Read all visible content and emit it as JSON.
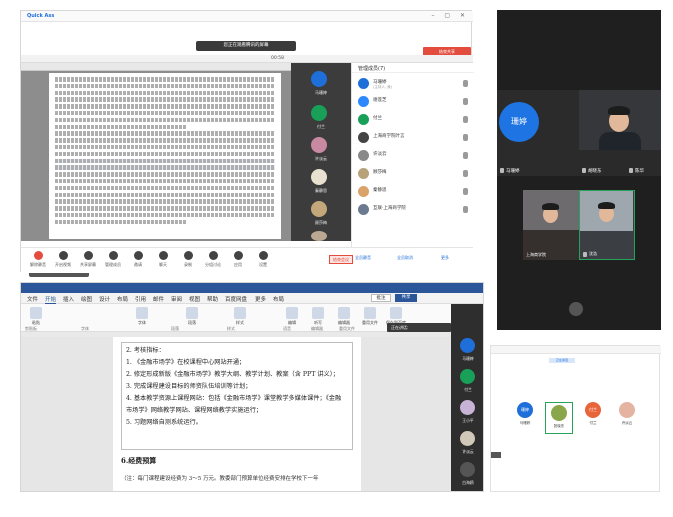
{
  "panel1": {
    "app_name": "Quick Ass",
    "window_info": "",
    "share_banner": "您正在观看腾讯的屏幕",
    "stop_share": "结束共享",
    "share_time": "00:58",
    "thumbnail_label": "共享中",
    "members_title": "管理成员(7)",
    "members": [
      {
        "name": "马珊婷",
        "sub": "(主持人, 我)",
        "color": "#1e6fd9"
      },
      {
        "name": "谢莲芝",
        "sub": "",
        "color": "#2d88ff"
      },
      {
        "name": "付兰",
        "sub": "",
        "color": "#18a058"
      },
      {
        "name": "上海商学院叶言",
        "sub": "",
        "color": "#444444"
      },
      {
        "name": "许淡云",
        "sub": "",
        "color": "#888888"
      },
      {
        "name": "顾莎梅",
        "sub": "",
        "color": "#b8a27a"
      },
      {
        "name": "秦静思",
        "sub": "",
        "color": "#d9a36b"
      },
      {
        "name": "互联·上海商学院",
        "sub": "",
        "color": "#6b7a8f"
      }
    ],
    "participants": [
      "马珊婷",
      "付兰",
      "许淡云",
      "秦静思",
      "顾莎梅",
      ""
    ],
    "toolbar": [
      "解除静音",
      "开启视频",
      "共享屏幕",
      "管理成员",
      "邀请",
      "聊天",
      "录制",
      "分组讨论",
      "应用",
      "设置"
    ],
    "end_button": "结束会议",
    "footer_buttons": [
      "全员静音",
      "全员取消",
      "更多"
    ]
  },
  "panel2": {
    "status": "",
    "big_avatar": "珊婷",
    "tiles": [
      "马珊婷",
      "胡晓东",
      "陈华",
      "上海商学院",
      "沈浩"
    ]
  },
  "panel3": {
    "title": "",
    "tabs": [
      "文件",
      "开始",
      "插入",
      "绘图",
      "设计",
      "布局",
      "引用",
      "邮件",
      "审阅",
      "视图",
      "帮助",
      "百度网盘",
      "更多",
      "布局"
    ],
    "active_tab": "开始",
    "share_label": "批注",
    "share_button": "共享",
    "ribbon_labels": [
      "粘贴",
      "字体",
      "段落",
      "样式",
      "编辑",
      "听写",
      "编辑器",
      "重用文件",
      "保存到百度网盘"
    ],
    "ribbon_groups": [
      "剪贴板",
      "字体",
      "段落",
      "样式",
      "语音",
      "编辑器",
      "重用文件",
      "保存"
    ],
    "speaking": "正在讲话:",
    "doc_lines": [
      "2. 考核指标：",
      "1. 《金融市场学》在校课程中心网站开通；",
      "2. 修定形成新版《金融市场学》教学大纲、教学计划、教案（含 PPT 讲义）；",
      "3. 完成课程建设目标的师资队伍培训等计划；",
      "4. 基本教学资源上课程网站：包括《金融市场学》课堂教学多媒体课件；《金融",
      "市场学》网络教学网站、课程网络教学实施运行；",
      "5. 习题网络自测系统运行。"
    ],
    "heading": "6.经费预算",
    "note": "（注：每门课程建设经费为 3～5 万元。教委部门预算单位经费安排在学校下一年",
    "side_names": [
      "马珊婷",
      "付兰",
      "王小平",
      "许淡云",
      "白海鸥"
    ]
  },
  "panel4": {
    "tag": "正在讲话",
    "tiles": [
      {
        "label": "珊婷",
        "name": "马珊婷",
        "color": "#1e6fd9"
      },
      {
        "label": "",
        "name": "张晓东",
        "color": "#8aa64b"
      },
      {
        "label": "付兰",
        "name": "付兰",
        "color": "#e8653a"
      },
      {
        "label": "",
        "name": "许淡云",
        "color": "#e5b3a1"
      }
    ]
  }
}
